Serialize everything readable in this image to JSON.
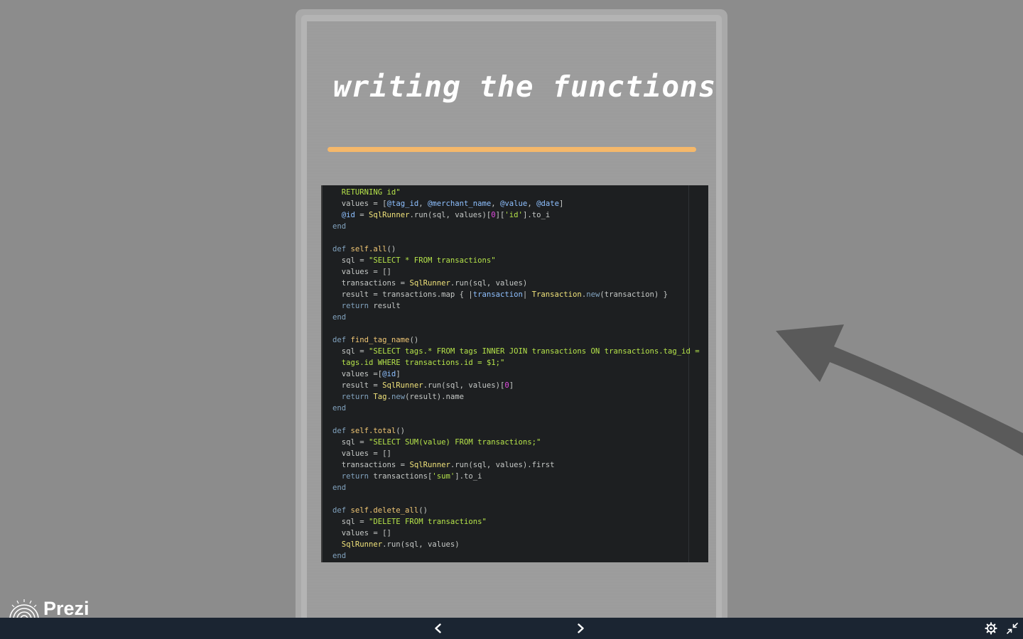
{
  "slide": {
    "title": "writing the functions"
  },
  "colors": {
    "background": "#8c8c8c",
    "accent_rule": "#f5b86a",
    "code_background": "#1d1f21",
    "bottom_bar": "#1b2532"
  },
  "code": {
    "lines": [
      [
        {
          "t": "  ",
          "c": "plain"
        },
        {
          "t": "RETURNING id\"",
          "c": "str"
        }
      ],
      [
        {
          "t": "  values = ",
          "c": "plain"
        },
        {
          "t": "[",
          "c": "plain"
        },
        {
          "t": "@tag_id",
          "c": "ivar"
        },
        {
          "t": ", ",
          "c": "plain"
        },
        {
          "t": "@merchant_name",
          "c": "ivar"
        },
        {
          "t": ", ",
          "c": "plain"
        },
        {
          "t": "@value",
          "c": "ivar"
        },
        {
          "t": ", ",
          "c": "plain"
        },
        {
          "t": "@date",
          "c": "ivar"
        },
        {
          "t": "]",
          "c": "plain"
        }
      ],
      [
        {
          "t": "  ",
          "c": "plain"
        },
        {
          "t": "@id",
          "c": "ivar"
        },
        {
          "t": " = ",
          "c": "plain"
        },
        {
          "t": "SqlRunner",
          "c": "const"
        },
        {
          "t": ".run(sql, values)[",
          "c": "plain"
        },
        {
          "t": "0",
          "c": "num"
        },
        {
          "t": "][",
          "c": "plain"
        },
        {
          "t": "'id'",
          "c": "str"
        },
        {
          "t": "].to_i",
          "c": "plain"
        }
      ],
      [
        {
          "t": "end",
          "c": "kw"
        }
      ],
      [
        {
          "t": "",
          "c": "plain"
        }
      ],
      [
        {
          "t": "def ",
          "c": "kw"
        },
        {
          "t": "self.all",
          "c": "fn"
        },
        {
          "t": "()",
          "c": "plain"
        }
      ],
      [
        {
          "t": "  sql = ",
          "c": "plain"
        },
        {
          "t": "\"SELECT * FROM transactions\"",
          "c": "str"
        }
      ],
      [
        {
          "t": "  values = []",
          "c": "plain"
        }
      ],
      [
        {
          "t": "  transactions = ",
          "c": "plain"
        },
        {
          "t": "SqlRunner",
          "c": "const"
        },
        {
          "t": ".run(sql, values)",
          "c": "plain"
        }
      ],
      [
        {
          "t": "  result = transactions.map { |",
          "c": "plain"
        },
        {
          "t": "transaction",
          "c": "ivar"
        },
        {
          "t": "| ",
          "c": "plain"
        },
        {
          "t": "Transaction",
          "c": "const"
        },
        {
          "t": ".",
          "c": "plain"
        },
        {
          "t": "new",
          "c": "kw"
        },
        {
          "t": "(transaction) }",
          "c": "plain"
        }
      ],
      [
        {
          "t": "  ",
          "c": "plain"
        },
        {
          "t": "return",
          "c": "kw"
        },
        {
          "t": " result",
          "c": "plain"
        }
      ],
      [
        {
          "t": "end",
          "c": "kw"
        }
      ],
      [
        {
          "t": "",
          "c": "plain"
        }
      ],
      [
        {
          "t": "def ",
          "c": "kw"
        },
        {
          "t": "find_tag_name",
          "c": "fn"
        },
        {
          "t": "()",
          "c": "plain"
        }
      ],
      [
        {
          "t": "  sql = ",
          "c": "plain"
        },
        {
          "t": "\"SELECT tags.* FROM tags INNER JOIN transactions ON transactions.tag_id =",
          "c": "str"
        }
      ],
      [
        {
          "t": "  ",
          "c": "plain"
        },
        {
          "t": "tags.id WHERE transactions.id = $1;\"",
          "c": "str"
        }
      ],
      [
        {
          "t": "  values =",
          "c": "plain"
        },
        {
          "t": "[",
          "c": "plain"
        },
        {
          "t": "@id",
          "c": "ivar"
        },
        {
          "t": "]",
          "c": "plain"
        }
      ],
      [
        {
          "t": "  result = ",
          "c": "plain"
        },
        {
          "t": "SqlRunner",
          "c": "const"
        },
        {
          "t": ".run(sql, values)[",
          "c": "plain"
        },
        {
          "t": "0",
          "c": "num"
        },
        {
          "t": "]",
          "c": "plain"
        }
      ],
      [
        {
          "t": "  ",
          "c": "plain"
        },
        {
          "t": "return ",
          "c": "kw"
        },
        {
          "t": "Tag",
          "c": "const"
        },
        {
          "t": ".",
          "c": "plain"
        },
        {
          "t": "new",
          "c": "kw"
        },
        {
          "t": "(result).name",
          "c": "plain"
        }
      ],
      [
        {
          "t": "end",
          "c": "kw"
        }
      ],
      [
        {
          "t": "",
          "c": "plain"
        }
      ],
      [
        {
          "t": "def ",
          "c": "kw"
        },
        {
          "t": "self.total",
          "c": "fn"
        },
        {
          "t": "()",
          "c": "plain"
        }
      ],
      [
        {
          "t": "  sql = ",
          "c": "plain"
        },
        {
          "t": "\"SELECT SUM(value) FROM transactions;\"",
          "c": "str"
        }
      ],
      [
        {
          "t": "  values = []",
          "c": "plain"
        }
      ],
      [
        {
          "t": "  transactions = ",
          "c": "plain"
        },
        {
          "t": "SqlRunner",
          "c": "const"
        },
        {
          "t": ".run(sql, values).first",
          "c": "plain"
        }
      ],
      [
        {
          "t": "  ",
          "c": "plain"
        },
        {
          "t": "return",
          "c": "kw"
        },
        {
          "t": " transactions[",
          "c": "plain"
        },
        {
          "t": "'sum'",
          "c": "str"
        },
        {
          "t": "].to_i",
          "c": "plain"
        }
      ],
      [
        {
          "t": "end",
          "c": "kw"
        }
      ],
      [
        {
          "t": "",
          "c": "plain"
        }
      ],
      [
        {
          "t": "def ",
          "c": "kw"
        },
        {
          "t": "self.delete_all",
          "c": "fn"
        },
        {
          "t": "()",
          "c": "plain"
        }
      ],
      [
        {
          "t": "  sql = ",
          "c": "plain"
        },
        {
          "t": "\"DELETE FROM transactions\"",
          "c": "str"
        }
      ],
      [
        {
          "t": "  values = []",
          "c": "plain"
        }
      ],
      [
        {
          "t": "  ",
          "c": "plain"
        },
        {
          "t": "SqlRunner",
          "c": "const"
        },
        {
          "t": ".run(sql, values)",
          "c": "plain"
        }
      ],
      [
        {
          "t": "end",
          "c": "kw"
        }
      ]
    ]
  },
  "brand": {
    "logo_text": "Prezi",
    "icon": "prezi-logo-icon"
  },
  "controls": {
    "prev_icon": "chevron-left-icon",
    "next_icon": "chevron-right-icon",
    "settings_icon": "gear-icon",
    "fullscreen_icon": "exit-fullscreen-icon"
  }
}
